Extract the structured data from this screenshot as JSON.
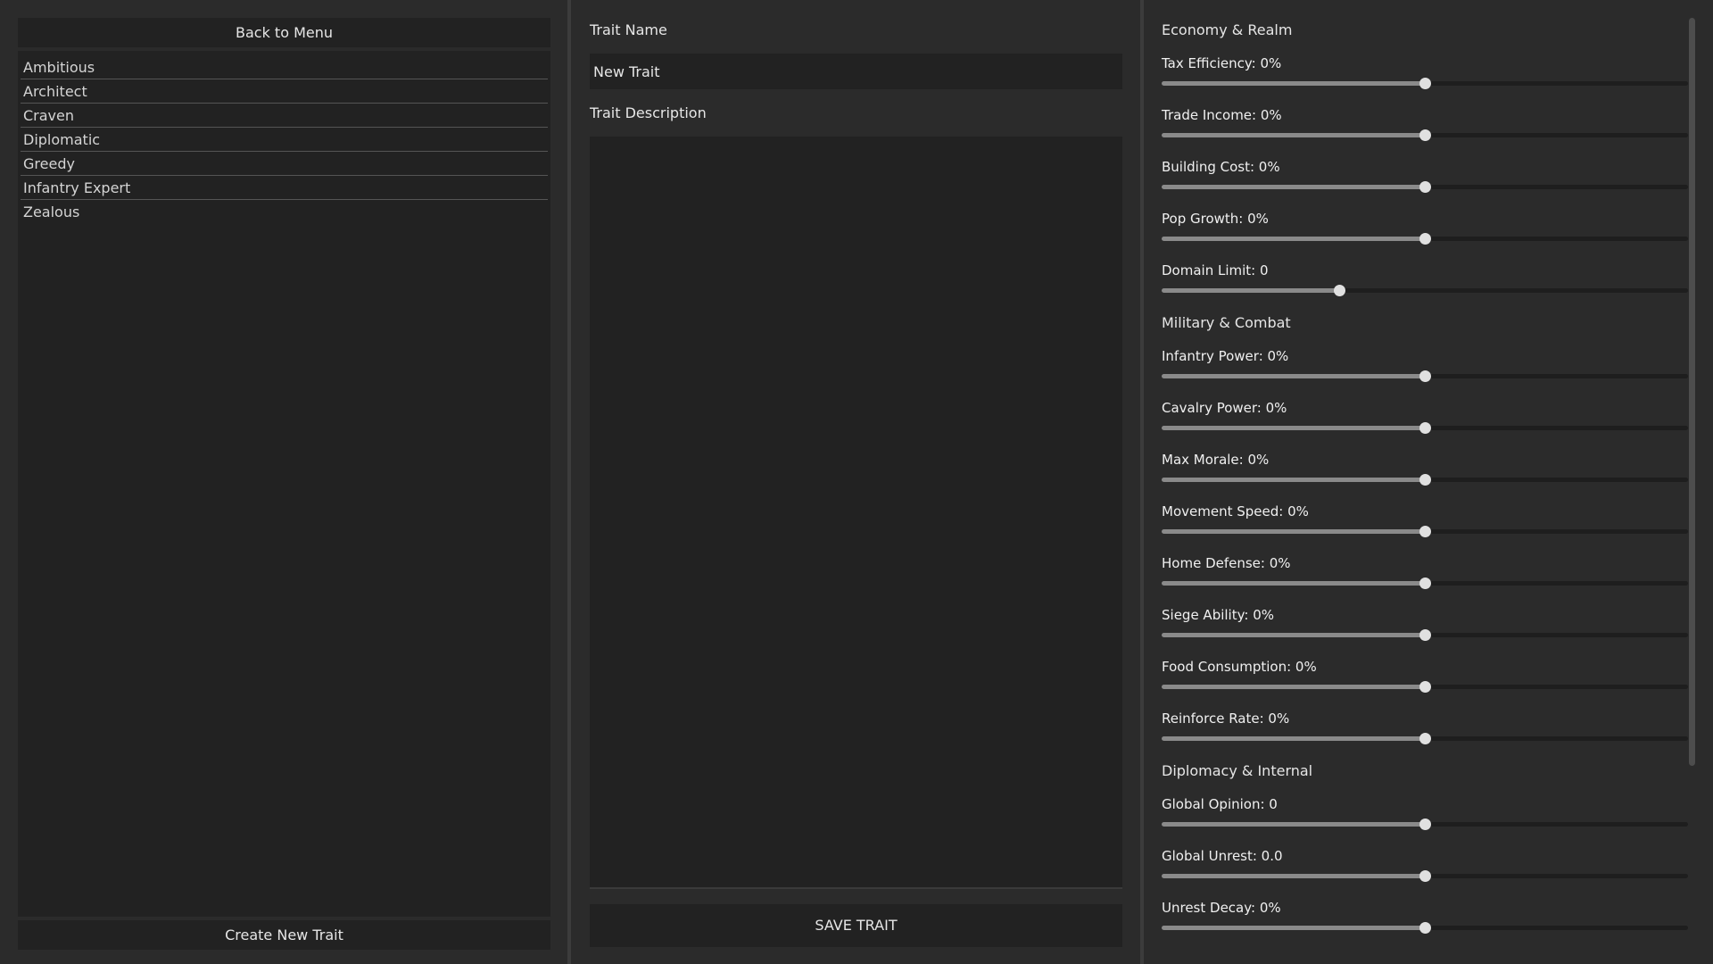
{
  "left": {
    "back_label": "Back to Menu",
    "traits": [
      "Ambitious",
      "Architect",
      "Craven",
      "Diplomatic",
      "Greedy",
      "Infantry Expert",
      "Zealous"
    ],
    "create_label": "Create New Trait"
  },
  "editor": {
    "name_label": "Trait Name",
    "name_value": "New Trait",
    "desc_label": "Trait Description",
    "desc_value": "",
    "save_label": "SAVE TRAIT"
  },
  "modifiers": {
    "sections": [
      {
        "title": "Economy & Realm",
        "sliders": [
          {
            "label": "Tax Efficiency: 0%",
            "value": 0.5
          },
          {
            "label": "Trade Income: 0%",
            "value": 0.5
          },
          {
            "label": "Building Cost: 0%",
            "value": 0.5
          },
          {
            "label": "Pop Growth: 0%",
            "value": 0.5
          },
          {
            "label": "Domain Limit: 0",
            "value": 0.337
          }
        ]
      },
      {
        "title": "Military & Combat",
        "sliders": [
          {
            "label": "Infantry Power: 0%",
            "value": 0.5
          },
          {
            "label": "Cavalry Power: 0%",
            "value": 0.5
          },
          {
            "label": "Max Morale: 0%",
            "value": 0.5
          },
          {
            "label": "Movement Speed: 0%",
            "value": 0.5
          },
          {
            "label": "Home Defense: 0%",
            "value": 0.5
          },
          {
            "label": "Siege Ability: 0%",
            "value": 0.5
          },
          {
            "label": "Food Consumption: 0%",
            "value": 0.5
          },
          {
            "label": "Reinforce Rate: 0%",
            "value": 0.5
          }
        ]
      },
      {
        "title": "Diplomacy & Internal",
        "sliders": [
          {
            "label": "Global Opinion: 0",
            "value": 0.5
          },
          {
            "label": "Global Unrest: 0.0",
            "value": 0.5
          },
          {
            "label": "Unrest Decay: 0%",
            "value": 0.5
          }
        ]
      }
    ]
  },
  "colors": {
    "background": "#2b2b2b",
    "panel": "#222222",
    "slider_fill": "#8a8a8a",
    "slider_knob": "#e0e0e0"
  }
}
